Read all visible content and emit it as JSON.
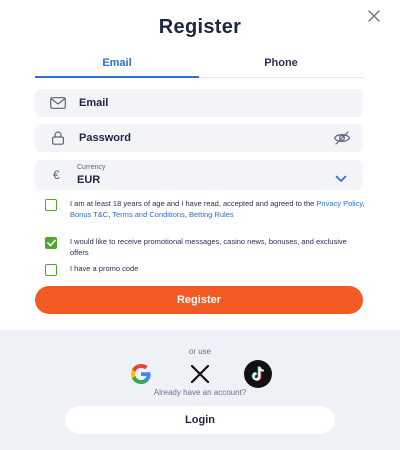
{
  "dialog": {
    "title": "Register"
  },
  "tabs": [
    {
      "label": "Email"
    },
    {
      "label": "Phone"
    }
  ],
  "form": {
    "email_placeholder": "Email",
    "password_placeholder": "Password",
    "currency": {
      "label": "Currency",
      "value": "EUR",
      "symbol": "€"
    }
  },
  "consents": {
    "age": {
      "checked": false,
      "text_prefix": "I am at least 18 years of age and I have read, accepted and agreed to the ",
      "link_privacy": "Privacy Policy",
      "sep1": ", ",
      "link_bonus": "Bonus T&C",
      "sep2": ", ",
      "link_terms": "Terms and Conditions",
      "sep3": ", ",
      "link_betting": "Betting Rules"
    },
    "promo_messages": {
      "checked": true,
      "text": "I would like to receive promotional messages, casino news, bonuses, and exclusive offers"
    },
    "promo_code": {
      "checked": false,
      "text": "I have a promo code"
    }
  },
  "buttons": {
    "register": "Register",
    "login": "Login"
  },
  "social": {
    "or_use": "or use",
    "providers": [
      "google-icon",
      "x-icon",
      "tiktok-icon"
    ],
    "already": "Already have an account?"
  },
  "colors": {
    "accent": "#f25a24",
    "link": "#2a6fd6",
    "check": "#52a52e",
    "title": "#1d2446"
  }
}
